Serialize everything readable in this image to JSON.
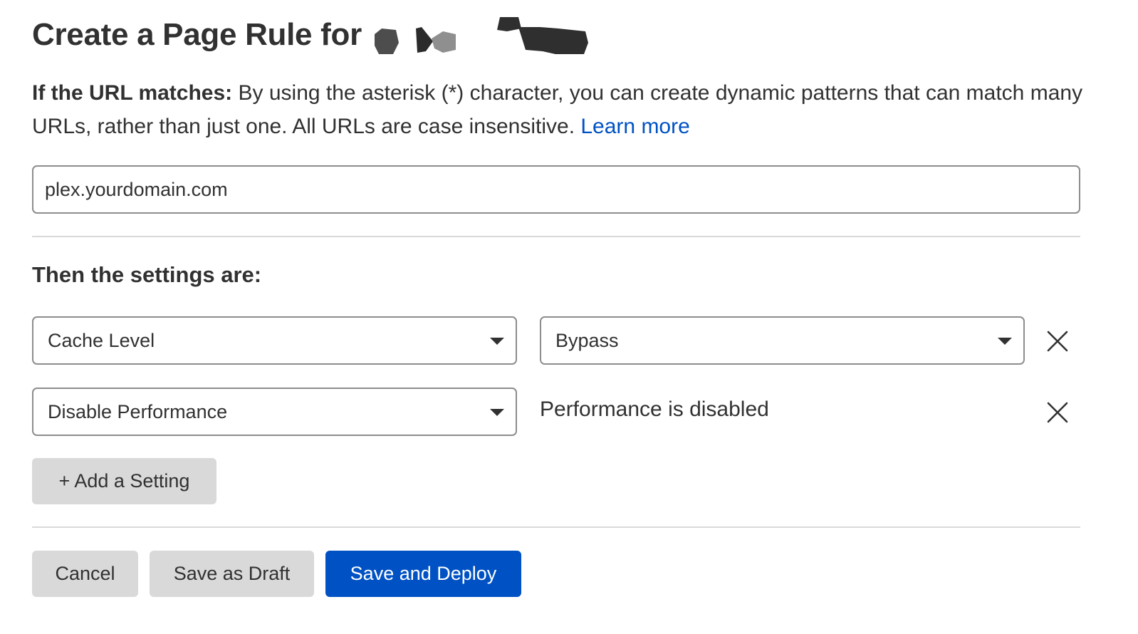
{
  "header": {
    "title": "Create a Page Rule for"
  },
  "url_section": {
    "label": "If the URL matches:",
    "description": " By using the asterisk (*) character, you can create dynamic patterns that can match many URLs, rather than just one. All URLs are case insensitive. ",
    "learn_more": "Learn more",
    "input_value": "plex.yourdomain.com"
  },
  "settings": {
    "heading": "Then the settings are:",
    "rows": [
      {
        "setting": "Cache Level",
        "value": "Bypass"
      },
      {
        "setting": "Disable Performance",
        "value": "Performance is disabled"
      }
    ],
    "add_label": "+ Add a Setting"
  },
  "footer": {
    "cancel_label": "Cancel",
    "draft_label": "Save as Draft",
    "deploy_label": "Save and Deploy"
  },
  "colors": {
    "accent": "#0051c3",
    "text": "#313131",
    "border": "#8d8d8d",
    "button_gray": "#d9d9d9"
  }
}
